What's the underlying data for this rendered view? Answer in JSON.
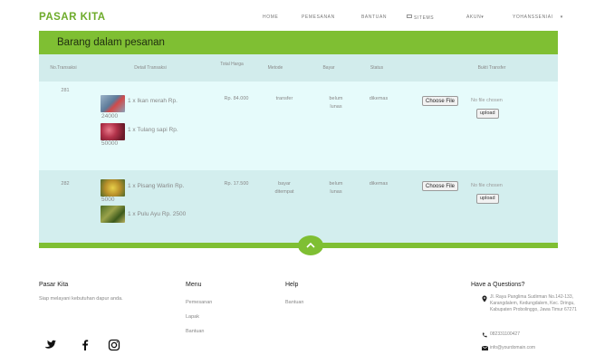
{
  "navbar": {
    "brand": "PASAR KITA",
    "items": [
      {
        "label": "HOME"
      },
      {
        "label": "PEMESANAN"
      },
      {
        "label": "BANTUAN"
      },
      {
        "label": "SITEMS"
      },
      {
        "label": "AKUN"
      },
      {
        "label": "YOHANSSENIAI"
      }
    ]
  },
  "panel": {
    "title": "Barang dalam pesanan",
    "columns": [
      "No.Transaksi",
      "Detail Transaksi",
      "Total Harga",
      "Metode",
      "Bayar",
      "Status",
      "Bukti Transfer"
    ],
    "rows": [
      {
        "id": "281",
        "items": [
          {
            "text": "1 x Ikan merah Rp.",
            "price": "24000"
          },
          {
            "text": "1 x Tulang sapi Rp.",
            "price": "50000"
          }
        ],
        "total": "Rp. 84.000",
        "method": "transfer",
        "payment": "belum lunas",
        "status": "dikemas",
        "file_button": "Choose File",
        "file_note": "No file chosen",
        "upload": "upload"
      },
      {
        "id": "282",
        "items": [
          {
            "text": "1 x Pisang Warlin Rp.",
            "price": "5000"
          },
          {
            "text": "1 x Pulu Ayu Rp. 2500",
            "price": ""
          }
        ],
        "total": "Rp. 17.500",
        "method": "bayar ditempat",
        "payment": "belum lunas",
        "status": "dikemas",
        "file_button": "Choose File",
        "file_note": "No file chosen",
        "upload": "upload"
      }
    ]
  },
  "footer": {
    "about_title": "Pasar Kita",
    "about_text": "Siap melayani kebutuhan dapur anda.",
    "menu_title": "Menu",
    "menu_links": [
      "Pemesanan",
      "Lapak",
      "Bantuan"
    ],
    "help_title": "Help",
    "help_links": [
      "Bantuan"
    ],
    "contact_title": "Have a Questions?",
    "address": "Jl. Raya Panglima Sudirman No.142-133, Karangdalem, Kedungdalem, Kec. Dringu, Kabupaten Probolinggo, Jawa Timur 67271",
    "phone": "082331100427",
    "email": "info@yourdomain.com",
    "social": [
      "twitter-icon",
      "facebook-icon",
      "instagram-icon"
    ]
  },
  "colors": {
    "brand": "#6dab2a",
    "header_green": "#7fbf33",
    "row_light": "#e6fbfb",
    "row_dark": "#d3eeee"
  }
}
